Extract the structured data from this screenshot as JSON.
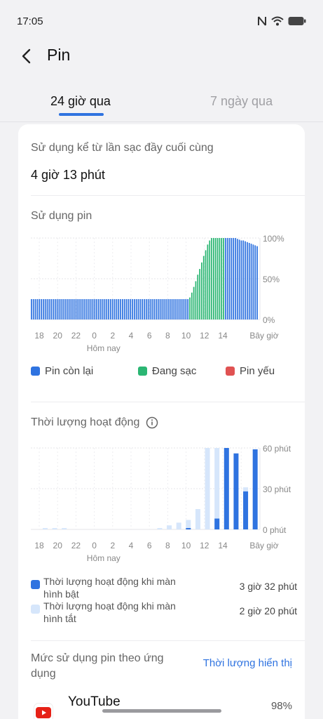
{
  "status_bar": {
    "time": "17:05",
    "icons": [
      "nfc-icon",
      "wifi-icon",
      "battery-icon"
    ]
  },
  "header": {
    "title": "Pin"
  },
  "tabs": [
    {
      "label": "24 giờ qua",
      "active": true
    },
    {
      "label": "7 ngày qua",
      "active": false
    }
  ],
  "summary": {
    "label": "Sử dụng kể từ lần sạc đầy cuối cùng",
    "value": "4 giờ 13 phút"
  },
  "battery_section": {
    "title": "Sử dụng pin",
    "legend": [
      {
        "label": "Pin còn lại",
        "color": "#2f73e0"
      },
      {
        "label": "Đang sạc",
        "color": "#2bb673"
      },
      {
        "label": "Pin yếu",
        "color": "#e05252"
      }
    ]
  },
  "activity_section": {
    "title": "Thời lượng hoạt động",
    "rows": [
      {
        "label": "Thời lượng hoạt động khi màn hình bật",
        "value": "3 giờ 32 phút",
        "color": "#2f73e0"
      },
      {
        "label": "Thời lượng hoạt động khi màn hình tắt",
        "value": "2 giờ 20 phút",
        "color": "#d6e6fb"
      }
    ]
  },
  "app_usage": {
    "title": "Mức sử dụng pin theo ứng dụng",
    "link": "Thời lượng hiển thị",
    "apps": [
      {
        "name": "YouTube",
        "percent": "98%"
      }
    ]
  },
  "chart_data": [
    {
      "type": "bar",
      "title": "Sử dụng pin",
      "y_ticks": [
        "100%",
        "50%",
        "0%"
      ],
      "ylim": [
        0,
        100
      ],
      "x_ticks": [
        "18",
        "20",
        "22",
        "0",
        "2",
        "4",
        "6",
        "8",
        "10",
        "12",
        "14",
        "Bây giờ"
      ],
      "x_sublabel": "Hôm nay",
      "series": [
        {
          "name": "Pin còn lại",
          "color": "#2f73e0",
          "values": [
            25,
            25,
            25,
            25,
            25,
            25,
            25,
            25,
            25,
            25,
            25,
            25,
            25,
            25,
            25,
            25,
            25,
            25,
            25,
            25,
            25,
            25,
            25,
            25,
            25,
            25,
            25,
            25,
            25,
            25,
            25,
            25,
            25,
            25,
            25,
            25,
            25,
            25,
            25,
            25,
            25,
            25,
            25,
            25,
            25,
            25,
            25,
            25,
            25,
            25,
            25,
            25,
            25,
            25,
            25,
            25,
            25,
            25,
            25,
            25,
            25,
            25,
            25,
            25,
            25,
            25,
            25,
            25,
            25,
            25,
            25,
            25,
            25,
            25,
            25,
            25,
            25,
            25,
            25,
            25,
            0,
            0,
            0,
            0,
            0,
            0,
            0,
            0,
            0,
            0,
            0,
            0,
            0,
            0,
            0,
            0,
            0,
            0,
            100,
            100,
            100,
            100,
            100,
            100,
            99,
            98,
            97,
            97,
            96,
            95,
            94,
            93,
            92,
            91,
            90
          ]
        },
        {
          "name": "Đang sạc",
          "color": "#2bb673",
          "values": [
            0,
            0,
            0,
            0,
            0,
            0,
            0,
            0,
            0,
            0,
            0,
            0,
            0,
            0,
            0,
            0,
            0,
            0,
            0,
            0,
            0,
            0,
            0,
            0,
            0,
            0,
            0,
            0,
            0,
            0,
            0,
            0,
            0,
            0,
            0,
            0,
            0,
            0,
            0,
            0,
            0,
            0,
            0,
            0,
            0,
            0,
            0,
            0,
            0,
            0,
            0,
            0,
            0,
            0,
            0,
            0,
            0,
            0,
            0,
            0,
            0,
            0,
            0,
            0,
            0,
            0,
            0,
            0,
            0,
            0,
            0,
            0,
            0,
            0,
            0,
            0,
            0,
            0,
            0,
            0,
            27,
            33,
            40,
            47,
            55,
            62,
            70,
            78,
            85,
            92,
            97,
            100,
            100,
            100,
            100,
            100,
            100,
            100,
            0,
            0,
            0,
            0,
            0,
            0,
            0,
            0,
            0,
            0,
            0,
            0,
            0,
            0,
            0,
            0,
            0
          ]
        }
      ],
      "note": "Blue bars drawn at remaining-battery %; green bars where charging."
    },
    {
      "type": "bar",
      "title": "Thời lượng hoạt động",
      "y_ticks": [
        "60 phút",
        "30 phút",
        "0 phút"
      ],
      "ylim": [
        0,
        60
      ],
      "x_ticks": [
        "18",
        "20",
        "22",
        "0",
        "2",
        "4",
        "6",
        "8",
        "10",
        "12",
        "14",
        "Bây giờ"
      ],
      "x_sublabel": "Hôm nay",
      "categories": [
        "17",
        "18",
        "19",
        "20",
        "21",
        "22",
        "23",
        "0",
        "1",
        "2",
        "3",
        "4",
        "5",
        "6",
        "7",
        "8",
        "9",
        "10",
        "11",
        "12",
        "13",
        "14",
        "15",
        "16"
      ],
      "series": [
        {
          "name": "Thời lượng hoạt động khi màn hình tắt",
          "color": "#d6e6fb",
          "values": [
            0,
            1,
            1,
            1,
            0,
            0,
            0,
            0,
            0,
            0,
            0,
            0,
            0,
            1,
            3,
            5,
            7,
            15,
            60,
            60,
            0,
            0,
            31,
            0
          ]
        },
        {
          "name": "Thời lượng hoạt động khi màn hình bật",
          "color": "#2f73e0",
          "values": [
            0,
            0,
            0,
            0,
            0,
            0,
            0,
            0,
            0,
            0,
            0,
            0,
            0,
            0,
            0,
            0,
            1,
            0,
            0,
            8,
            60,
            56,
            28,
            59
          ]
        }
      ]
    }
  ]
}
